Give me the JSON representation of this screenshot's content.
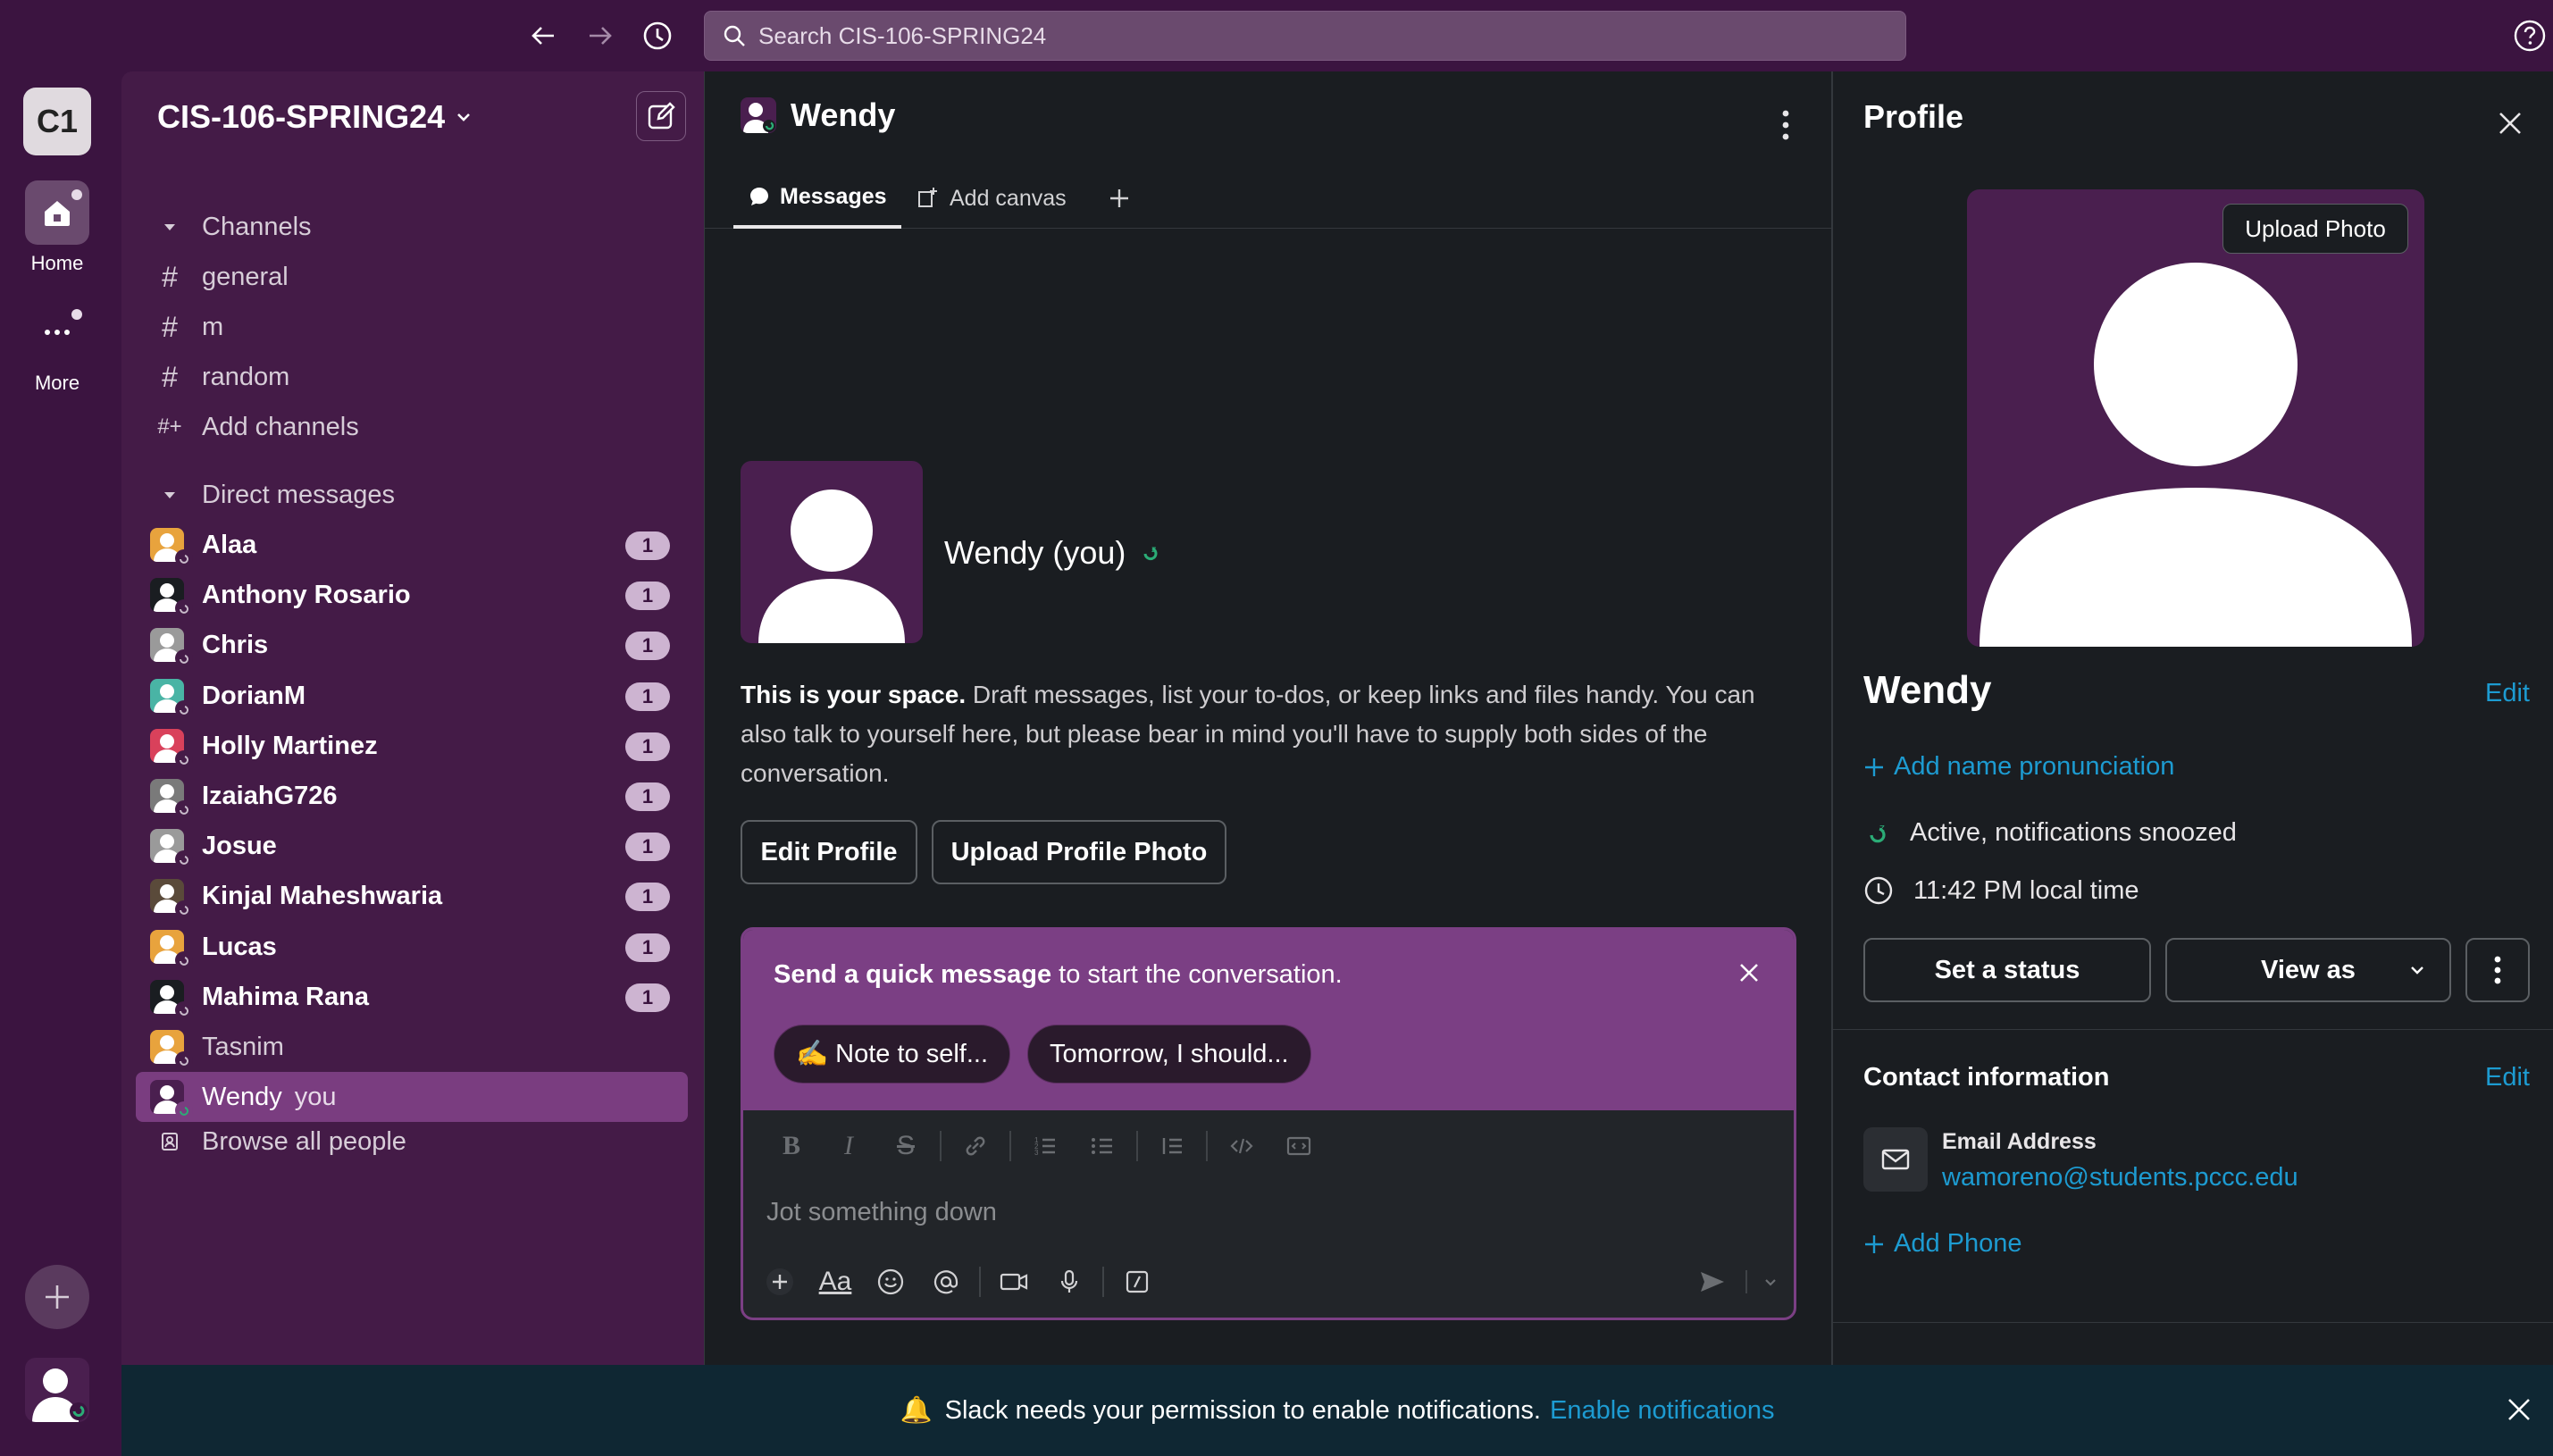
{
  "search": {
    "placeholder": "Search CIS-106-SPRING24"
  },
  "workspace": {
    "initials": "C1",
    "name": "CIS-106-SPRING24"
  },
  "rail": {
    "home_label": "Home",
    "more_label": "More"
  },
  "sidebar": {
    "channels_header": "Channels",
    "channels": [
      "general",
      "m",
      "random"
    ],
    "add_channels": "Add channels",
    "dm_header": "Direct messages",
    "dms": [
      {
        "name": "Alaa",
        "badge": "1",
        "color": "#e8a33d"
      },
      {
        "name": "Anthony Rosario",
        "badge": "1",
        "color": "#1a1d21"
      },
      {
        "name": "Chris",
        "badge": "1",
        "color": "#9a9a9a"
      },
      {
        "name": "DorianM",
        "badge": "1",
        "color": "#49b4a5"
      },
      {
        "name": "Holly Martinez",
        "badge": "1",
        "color": "#d9415b"
      },
      {
        "name": "IzaiahG726",
        "badge": "1",
        "color": "#7a7a7a"
      },
      {
        "name": "Josue",
        "badge": "1",
        "color": "#9a9a9a"
      },
      {
        "name": "Kinjal Maheshwaria",
        "badge": "1",
        "color": "#5a4a3a"
      },
      {
        "name": "Lucas",
        "badge": "1",
        "color": "#e8a33d"
      },
      {
        "name": "Mahima Rana",
        "badge": "1",
        "color": "#1a1d21"
      },
      {
        "name": "Tasnim",
        "badge": "",
        "color": "#e8a33d"
      },
      {
        "name": "Wendy",
        "suffix": "you",
        "badge": "",
        "color": "#4a1f4f"
      }
    ],
    "browse_people": "Browse all people"
  },
  "channel": {
    "title": "Wendy",
    "tabs": [
      "Messages",
      "Add canvas"
    ],
    "intro_name": "Wendy (you)",
    "intro_bold": "This is your space.",
    "intro_rest": " Draft messages, list your to-dos, or keep links and files handy. You can also talk to yourself here, but please bear in mind you'll have to supply both sides of the conversation.",
    "edit_profile": "Edit Profile",
    "upload_profile_photo": "Upload Profile Photo",
    "quick_bold": "Send a quick message",
    "quick_rest": " to start the conversation.",
    "chip1": "✍️ Note to self...",
    "chip2": "Tomorrow, I should...",
    "composer_placeholder": "Jot something down"
  },
  "profile": {
    "title": "Profile",
    "upload_photo": "Upload Photo",
    "name": "Wendy",
    "edit": "Edit",
    "add_pronunciation": "Add name pronunciation",
    "status": "Active, notifications snoozed",
    "local_time": "11:42 PM local time",
    "set_status": "Set a status",
    "view_as": "View as",
    "contact_header": "Contact information",
    "contact_edit": "Edit",
    "email_label": "Email Address",
    "email": "wamoreno@students.pccc.edu",
    "add_phone": "Add Phone"
  },
  "notification": {
    "icon": "🔔",
    "text": "Slack needs your permission to enable notifications.",
    "link": "Enable notifications"
  },
  "colors": {
    "aubergine": "#3b1440",
    "accent_link": "#1d9bd1",
    "active_item": "#7a3d80"
  }
}
